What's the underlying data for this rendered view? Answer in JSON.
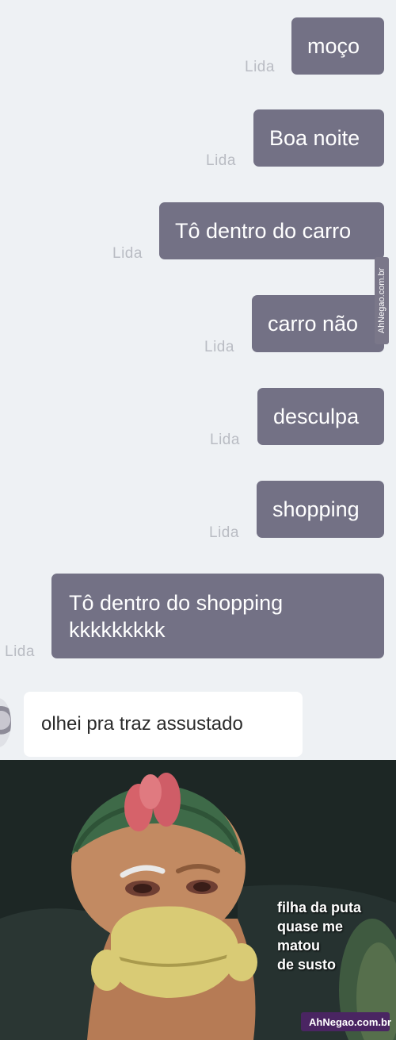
{
  "messages": [
    {
      "text": "moço",
      "status": "Lida"
    },
    {
      "text": "Boa noite",
      "status": "Lida"
    },
    {
      "text": "Tô dentro do carro",
      "status": "Lida"
    },
    {
      "text": "carro não",
      "status": "Lida"
    },
    {
      "text": "desculpa",
      "status": "Lida"
    },
    {
      "text": "shopping",
      "status": "Lida"
    },
    {
      "text_line1": "Tô dentro do shopping",
      "text_line2": "kkkkkkkkk",
      "status": "Lida"
    }
  ],
  "reply": {
    "text": "olhei pra traz assustado"
  },
  "watermark": {
    "side": "AhNegao.com.br",
    "bottom": "AhNegao.com.br"
  },
  "meme": {
    "caption_lines": [
      "filha da puta",
      "quase me matou",
      "de susto"
    ]
  },
  "colors": {
    "bubble": "#737185",
    "background": "#eef1f4",
    "status_text": "#b9bcc3"
  }
}
